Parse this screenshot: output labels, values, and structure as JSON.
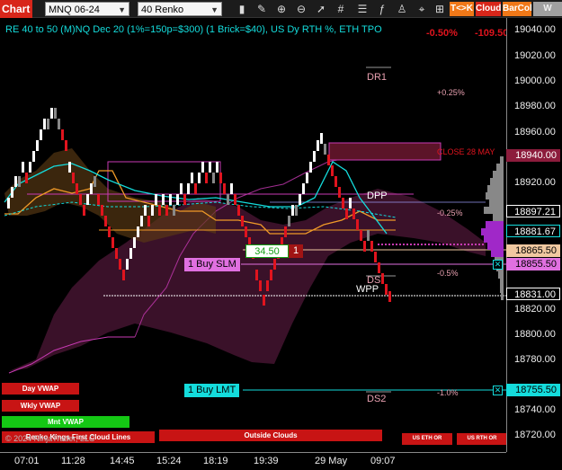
{
  "toolbar": {
    "chart_tab": "Chart",
    "instrument": "MNQ 06-24",
    "period": "40 Renko",
    "buttons": [
      {
        "label": "T<>K",
        "color": "#f07818"
      },
      {
        "label": "Cloud",
        "color": "#d8261a"
      },
      {
        "label": "BarCol",
        "color": "#f07818"
      },
      {
        "label": "W VWA",
        "color": "#a0a0a0"
      }
    ],
    "icons": [
      "bar-chart-icon",
      "draw-tools-icon",
      "zoom-in-icon",
      "zoom-out-icon",
      "pointer-icon",
      "hash-icon",
      "properties-icon",
      "indicators-icon",
      "strategy-icon",
      "dom-icon"
    ]
  },
  "chart": {
    "title": "RE 40 to 50 (M)NQ Dec 20 (1%=150p=$300) (1 Brick=$40), US Dy RTH %, ETH TPO",
    "pnl_overlap_a": "-0.50%",
    "pnl_overlap_b": "-109.50",
    "levels": {
      "dr1": "DR1",
      "dpp": "DPP",
      "ds": "DS",
      "wpp": "WPP",
      "ds2": "DS2",
      "close": "CLOSE 28 MAY"
    },
    "pct_labels": [
      "+0.25%",
      "-0.25%",
      "-0.5%",
      "-1.0%"
    ],
    "position": {
      "qty_text": "34.50",
      "count": "1"
    },
    "orders": {
      "buy_slm": "1 Buy SLM",
      "buy_lmt": "1 Buy LMT",
      "close_x": "✕"
    },
    "bottom_buttons": {
      "day_vwap": "Day VWAP",
      "wkly_vwap": "Wkly VWAP",
      "mnt_vwap": "Mnt VWAP",
      "outside_clouds": "Outside Clouds",
      "us_eth_or": "US ETH OR",
      "us_rth_or": "US RTH OR"
    },
    "copyright": "© 2024 NinjaTrader, LLC",
    "watermark": "Renko Kings First Cloud Lines"
  },
  "price_axis": {
    "ticks": [
      "19040.00",
      "19020.00",
      "19000.00",
      "18980.00",
      "18960.00",
      "18940.00",
      "18920.00",
      "18900.00",
      "18880.00",
      "18860.00",
      "18840.00",
      "18820.00",
      "18800.00",
      "18780.00",
      "18760.00",
      "18740.00",
      "18720.00"
    ],
    "labels": [
      {
        "text": "18940.00",
        "bg": "#8c1c3c",
        "fg": "#ffffff"
      },
      {
        "text": "18897.21",
        "bg": "#000000",
        "fg": "#ffffff",
        "border": "#ffffff"
      },
      {
        "text": "18881.67",
        "bg": "#000000",
        "fg": "#ffffff",
        "border": "#14dcdc"
      },
      {
        "text": "18865.50",
        "bg": "#f0c8a0",
        "fg": "#000000"
      },
      {
        "text": "18855.50",
        "bg": "#e070e0",
        "fg": "#000000"
      },
      {
        "text": "18831.00",
        "bg": "#000000",
        "fg": "#ffffff",
        "border": "#ffffff"
      },
      {
        "text": "18755.50",
        "bg": "#14dcdc",
        "fg": "#000000"
      }
    ]
  },
  "time_axis": {
    "ticks": [
      "07:01",
      "11:28",
      "14:45",
      "15:24",
      "18:19",
      "19:39",
      "29 May",
      "09:07"
    ]
  },
  "colors": {
    "up_brick": "#ffffff",
    "down_brick": "#e0141e",
    "cloud": "#6a1f4a",
    "cyan": "#14dcdc",
    "orange": "#f09a28",
    "magenta": "#c83ab4"
  }
}
